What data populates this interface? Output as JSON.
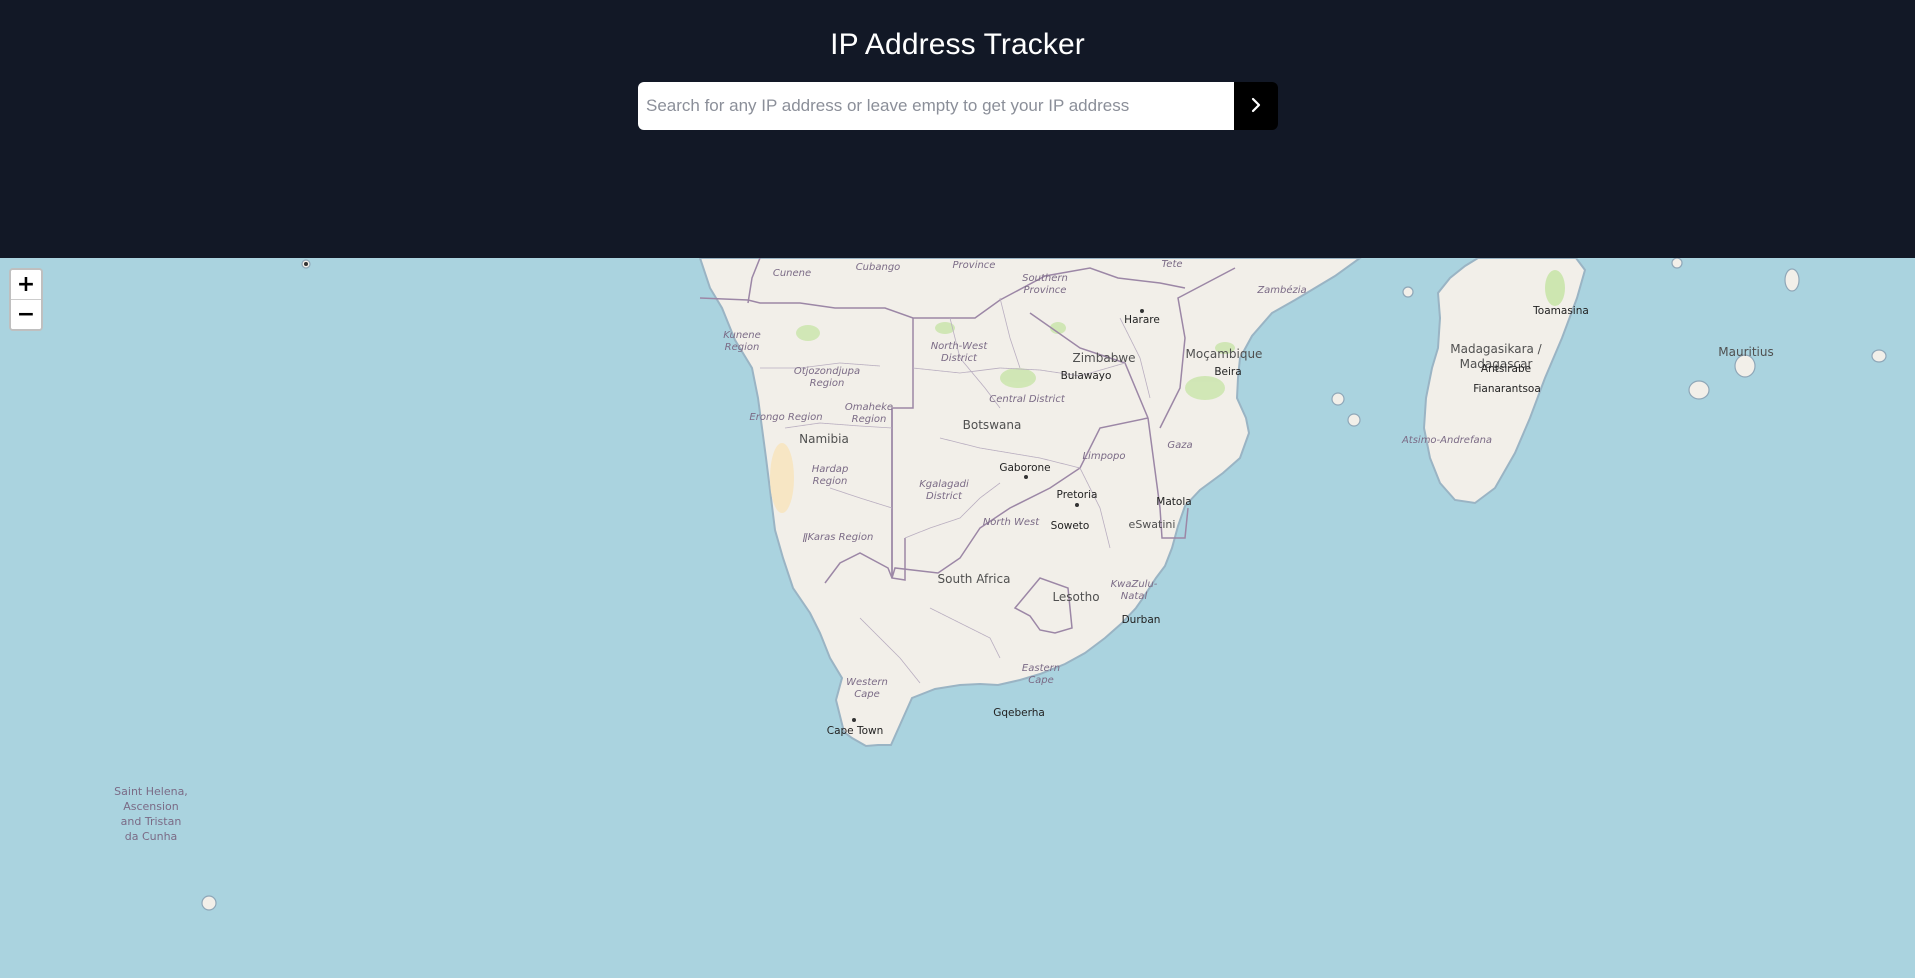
{
  "header": {
    "title": "IP Address Tracker",
    "search": {
      "placeholder": "Search for any IP address or leave empty to get your IP address",
      "value": "",
      "submit_icon": "chevron-right-icon"
    }
  },
  "map": {
    "zoom_in": "+",
    "zoom_out": "−",
    "labels": {
      "namibia": "Namibia",
      "botswana": "Botswana",
      "zimbabwe": "Zimbabwe",
      "mocambique": "Moçambique",
      "south_africa": "South Africa",
      "lesotho": "Lesotho",
      "eswatini": "eSwatini",
      "madagascar_1": "Madagasikara /",
      "madagascar_2": "Madagascar",
      "mauritius": "Mauritius",
      "harare": "Harare",
      "beira": "Beira",
      "bulawayo": "Bulawayo",
      "gaborone": "Gaborone",
      "pretoria": "Pretoria",
      "soweto": "Soweto",
      "matola": "Matola",
      "durban": "Durban",
      "gqeberha": "Gqeberha",
      "cape_town": "Cape Town",
      "toamasina": "Toamasina",
      "antsirabe": "Antsirabe",
      "fianarantsoa": "Fianarantsoa",
      "cunene": "Cunene",
      "cuando_cubango": "Cubango",
      "province": "Province",
      "southern_1": "Southern",
      "southern_2": "Province",
      "tete": "Tete",
      "zambezia": "Zambézia",
      "kunene_1": "Kunene",
      "kunene_2": "Region",
      "otjozondjupa_1": "Otjozondjupa",
      "otjozondjupa_2": "Region",
      "omaheke_1": "Omaheke",
      "omaheke_2": "Region",
      "erongo": "Erongo Region",
      "hardap_1": "Hardap",
      "hardap_2": "Region",
      "karas": "ǁKaras Region",
      "north_west_district_1": "North-West",
      "north_west_district_2": "District",
      "central_district": "Central District",
      "kgalagadi_1": "Kgalagadi",
      "kgalagadi_2": "District",
      "limpopo": "Limpopo",
      "north_west": "North West",
      "gaza": "Gaza",
      "kwazulu_1": "KwaZulu-",
      "kwazulu_2": "Natal",
      "eastern_cape_1": "Eastern",
      "eastern_cape_2": "Cape",
      "western_cape_1": "Western",
      "western_cape_2": "Cape",
      "atsimo": "Atsimo-Andrefana",
      "saint_helena_1": "Saint Helena,",
      "saint_helena_2": "Ascension",
      "saint_helena_3": "and Tristan",
      "saint_helena_4": "da Cunha"
    }
  }
}
